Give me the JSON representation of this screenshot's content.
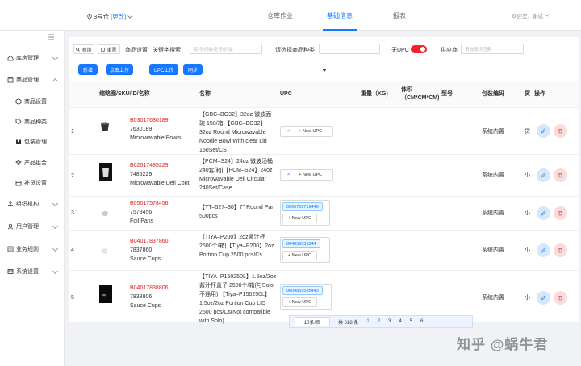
{
  "topbar": {
    "warehouse": "3号仓",
    "change": "[更改]",
    "tabs": [
      {
        "label": "仓库作业"
      },
      {
        "label": "基础信息"
      },
      {
        "label": "报表"
      }
    ],
    "welcome": "欢迎您，谢斌"
  },
  "sidebar": {
    "items": [
      {
        "label": "库房管理"
      },
      {
        "label": "商品管理"
      },
      {
        "label": "商品设置"
      },
      {
        "label": "商品种类"
      },
      {
        "label": "包装管理"
      },
      {
        "label": "产品组合"
      },
      {
        "label": "补货设置"
      },
      {
        "label": "组织机构"
      },
      {
        "label": "用户管理"
      },
      {
        "label": "业务规则"
      },
      {
        "label": "系统设置"
      }
    ]
  },
  "toolbar": {
    "query": "查询",
    "reset": "重置",
    "product_setting": "商品设置",
    "keyword_label": "关键字搜索",
    "keyword_placeholder": "名称/规格/型号/扫描",
    "category_label": "请选择商品种类",
    "no_upc": "无UPC",
    "supplier_label": "供应商",
    "supplier_placeholder": "请选择供应商",
    "new": "新增",
    "upload": "点击上传",
    "upc_upload": "UPC上传",
    "sync": "同步"
  },
  "table": {
    "headers": {
      "thumb": "缩略图/SKU/ID/名称",
      "name": "名称",
      "upc": "UPC",
      "weight": "重量（KG)",
      "volume": "体积（CM*CM*CM)",
      "model": "型号",
      "package": "包装编码",
      "shelf": "货",
      "ops": "操作"
    },
    "new_upc": "+ New UPC",
    "rows": [
      {
        "idx": "1",
        "sku": "B03017630189",
        "id": "7630189",
        "title": "Microwavable Bowls",
        "name": "【GBC–BO32】32oz 微波面碗 150/箱|【GBC–BO32】32oz Round Microwavable Noodle Bowl With clear Lid 150Set/CS",
        "upc": "",
        "package": "系统内置",
        "shelf": "货"
      },
      {
        "idx": "2",
        "sku": "B02017485229",
        "id": "7485229",
        "title": "Microwavable Deli Cont",
        "name": "【PCM–S24】24oz 微波汤桶 240套/箱|【PCM–S24】24oz Microwavable Deli Circular 240Set/Case",
        "upc": "",
        "package": "系统内置",
        "shelf": "小"
      },
      {
        "idx": "3",
        "sku": "B05017578456",
        "id": "7578456",
        "title": "Foil Pans",
        "name": "【TT–527–30】7\" Round Pan 500pcs",
        "upc": "0695769719449",
        "package": "系统内置",
        "shelf": "小"
      },
      {
        "idx": "4",
        "sku": "B04017837860",
        "id": "7837860",
        "title": "Sauce Cups",
        "name": "【TIYA–P200】2oz酱汁杯 2500个/箱|【TIya–P200】2oz Portion Cup 2500 pcs/Cs",
        "upc": "804859535344",
        "package": "系统内置",
        "shelf": "小"
      },
      {
        "idx": "5",
        "sku": "B04017838806",
        "id": "7838806",
        "title": "Sauce Cups",
        "name": "【TIYA–P150250L】1.5oz/2oz酱汁杯盖子 2500个/箱(与Solo不通用)|【Tiya–P150250L】1.5oz/2oz Portion Cup LID 2500 pcs/Cs(Not compatible with Solo)",
        "upc": "0804859535443",
        "package": "系统内置",
        "shelf": "小"
      }
    ]
  },
  "pager": {
    "page_size": "10条/页",
    "total": "共 618 条",
    "pages": [
      "1",
      "2",
      "3",
      "4",
      "5",
      "6"
    ]
  },
  "watermark": "知乎 @蜗牛君"
}
